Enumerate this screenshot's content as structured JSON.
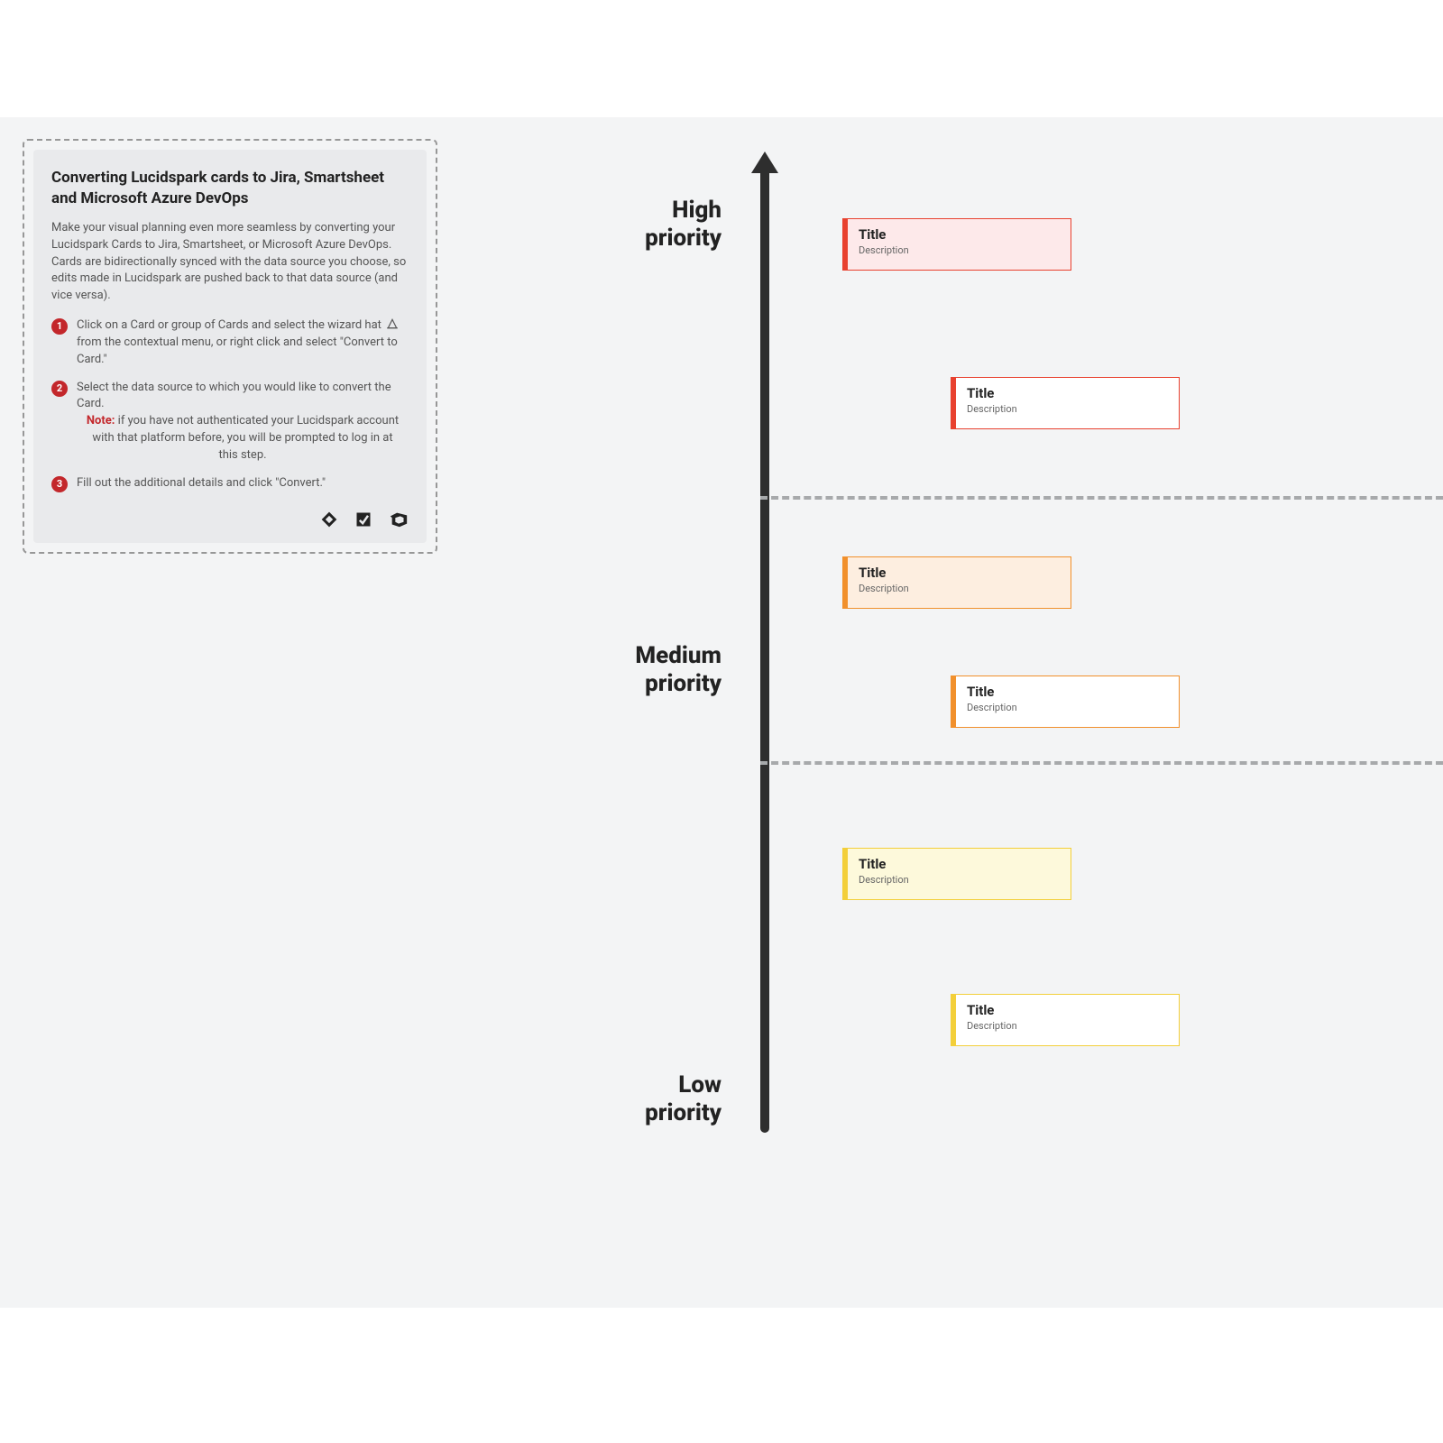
{
  "panel": {
    "title": "Converting Lucidspark cards to Jira, Smartsheet and Microsoft Azure DevOps",
    "intro": "Make your visual planning even more seamless by converting your Lucidspark Cards to Jira, Smartsheet, or Microsoft Azure DevOps. Cards are bidirectionally synced with the data source you choose, so edits made in Lucidspark are pushed back to that data source (and vice versa).",
    "steps": [
      {
        "num": "1",
        "text_a": "Click on a Card or group of Cards and select the wizard hat ",
        "text_b": " from the contextual menu, or right click and select \"Convert to Card.\""
      },
      {
        "num": "2",
        "text": "Select the data source to which you would like to convert the Card.",
        "note_label": "Note:",
        "note_text": " if you have not authenticated your Lucidspark account with that platform before, you will be prompted to log in at this step."
      },
      {
        "num": "3",
        "text": "Fill out the additional details and click \"Convert.\""
      }
    ]
  },
  "axis": {
    "high": "High priority",
    "medium": "Medium priority",
    "low": "Low priority"
  },
  "cards": [
    {
      "title": "Title",
      "desc": "Description"
    },
    {
      "title": "Title",
      "desc": "Description"
    },
    {
      "title": "Title",
      "desc": "Description"
    },
    {
      "title": "Title",
      "desc": "Description"
    },
    {
      "title": "Title",
      "desc": "Description"
    },
    {
      "title": "Title",
      "desc": "Description"
    }
  ]
}
